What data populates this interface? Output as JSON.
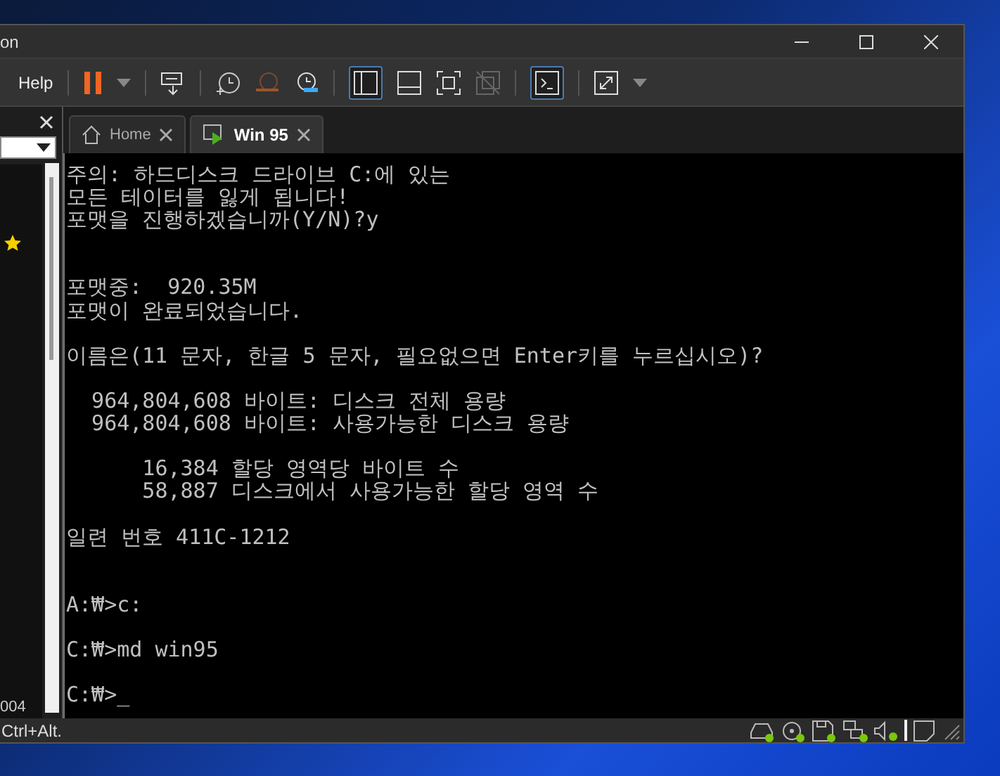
{
  "window": {
    "title": "on"
  },
  "menu": {
    "items": [
      "Help"
    ]
  },
  "sidebar": {
    "fragment": "004"
  },
  "tabs": [
    {
      "label": "Home",
      "selected": false
    },
    {
      "label": "Win 95",
      "selected": true
    }
  ],
  "console": {
    "blocks": [
      {
        "lines": [
          "주의: 하드디스크 드라이브 C:에 있는",
          "모든 테이터를 잃게 됩니다!",
          "포맷을 진행하겠습니까(Y/N)?y"
        ],
        "double_gap": true
      },
      {
        "lines": [
          "포맷중:  920.35M",
          "포맷이 완료되었습니다."
        ],
        "double_gap": false
      },
      {
        "lines": [
          "이름은(11 문자, 한글 5 문자, 필요없으면 Enter키를 누르십시오)?"
        ],
        "double_gap": false
      },
      {
        "lines": [
          "  964,804,608 바이트: 디스크 전체 용량",
          "  964,804,608 바이트: 사용가능한 디스크 용량"
        ],
        "double_gap": false
      },
      {
        "lines": [
          "      16,384 할당 영역당 바이트 수",
          "      58,887 디스크에서 사용가능한 할당 영역 수"
        ],
        "double_gap": false
      },
      {
        "lines": [
          "일련 번호 411C-1212"
        ],
        "double_gap": true
      },
      {
        "lines": [
          "A:₩>c:"
        ],
        "double_gap": false
      },
      {
        "lines": [
          "C:₩>md win95"
        ],
        "double_gap": false
      },
      {
        "lines": [
          "C:₩>_"
        ],
        "double_gap": false
      }
    ]
  },
  "status_bar": {
    "text": "Ctrl+Alt."
  }
}
